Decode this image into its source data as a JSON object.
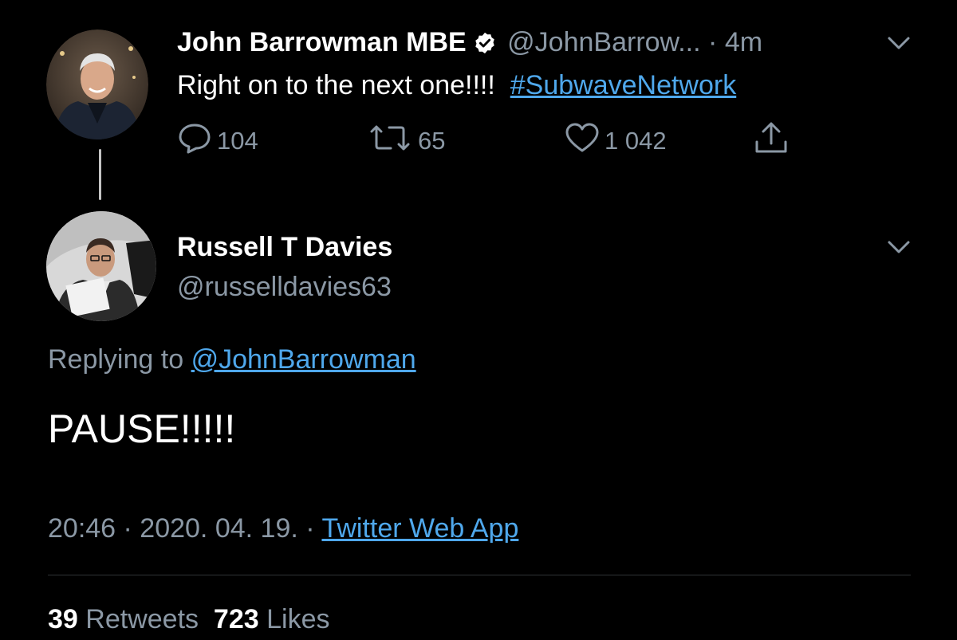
{
  "colors": {
    "background": "#000000",
    "text_primary": "#ffffff",
    "text_secondary": "#8b98a5",
    "link": "#4fa8ec"
  },
  "parent_tweet": {
    "author_name": "John Barrowman MBE",
    "handle": "@JohnBarrow...",
    "separator": "·",
    "time": "4m",
    "verified_icon": "verified-badge-icon",
    "avatar_icon": "avatar",
    "text": "Right on to the next one!!!!",
    "hashtag": "#SubwaveNetwork",
    "menu_icon": "chevron-down-icon",
    "actions": {
      "reply_count": "104",
      "retweet_count": "65",
      "like_count": "1 042",
      "reply_icon": "reply-icon",
      "retweet_icon": "retweet-icon",
      "like_icon": "heart-icon",
      "share_icon": "share-icon"
    }
  },
  "main_tweet": {
    "author_name": "Russell T Davies",
    "handle": "@russelldavies63",
    "menu_icon": "chevron-down-icon",
    "replying_prefix": "Replying to",
    "replying_to": "@JohnBarrowman",
    "text": "PAUSE!!!!!",
    "timestamp": "20:46 · 2020. 04. 19.",
    "separator": "·",
    "source": "Twitter Web App",
    "stats": {
      "retweets_count": "39",
      "retweets_label": "Retweets",
      "likes_count": "723",
      "likes_label": "Likes"
    }
  }
}
